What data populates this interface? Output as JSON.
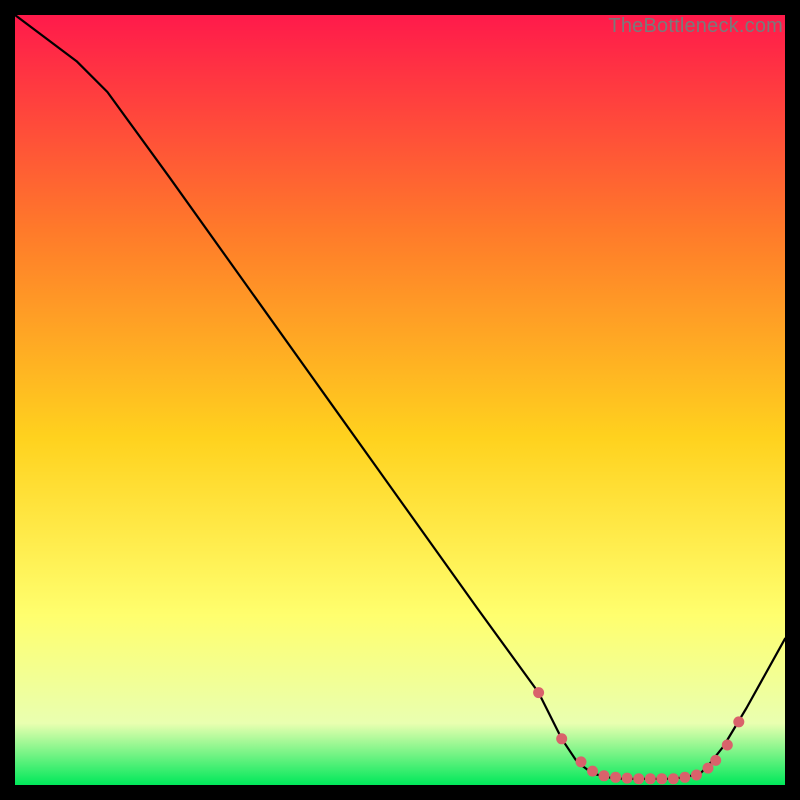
{
  "watermark": "TheBottleneck.com",
  "colors": {
    "gradient_top": "#ff1a4b",
    "gradient_mid1": "#ff7a2a",
    "gradient_mid2": "#ffd21e",
    "gradient_mid3": "#ffff6e",
    "gradient_mid4": "#e9ffb0",
    "gradient_bottom": "#00e85a",
    "line": "#000000",
    "dot": "#d9626b",
    "frame": "#000000"
  },
  "chart_data": {
    "type": "line",
    "title": "",
    "xlabel": "",
    "ylabel": "",
    "xlim": [
      0,
      100
    ],
    "ylim": [
      0,
      100
    ],
    "series": [
      {
        "name": "curve",
        "x": [
          0,
          8,
          12,
          20,
          30,
          40,
          50,
          60,
          68,
          71,
          73,
          75,
          77,
          79,
          81,
          83,
          85,
          87,
          89,
          90,
          92,
          95,
          100
        ],
        "y": [
          100,
          94,
          90,
          79,
          65,
          51,
          37,
          23,
          12,
          6,
          3,
          1.5,
          1,
          0.8,
          0.8,
          0.8,
          0.8,
          1,
          1.5,
          2.5,
          5,
          10,
          19
        ]
      }
    ],
    "dots": {
      "name": "highlighted-points",
      "x": [
        68,
        71,
        73.5,
        75,
        76.5,
        78,
        79.5,
        81,
        82.5,
        84,
        85.5,
        87,
        88.5,
        90,
        91,
        92.5,
        94
      ],
      "y": [
        12,
        6,
        3,
        1.8,
        1.2,
        1,
        0.9,
        0.8,
        0.8,
        0.8,
        0.8,
        1,
        1.3,
        2.2,
        3.2,
        5.2,
        8.2
      ]
    }
  }
}
